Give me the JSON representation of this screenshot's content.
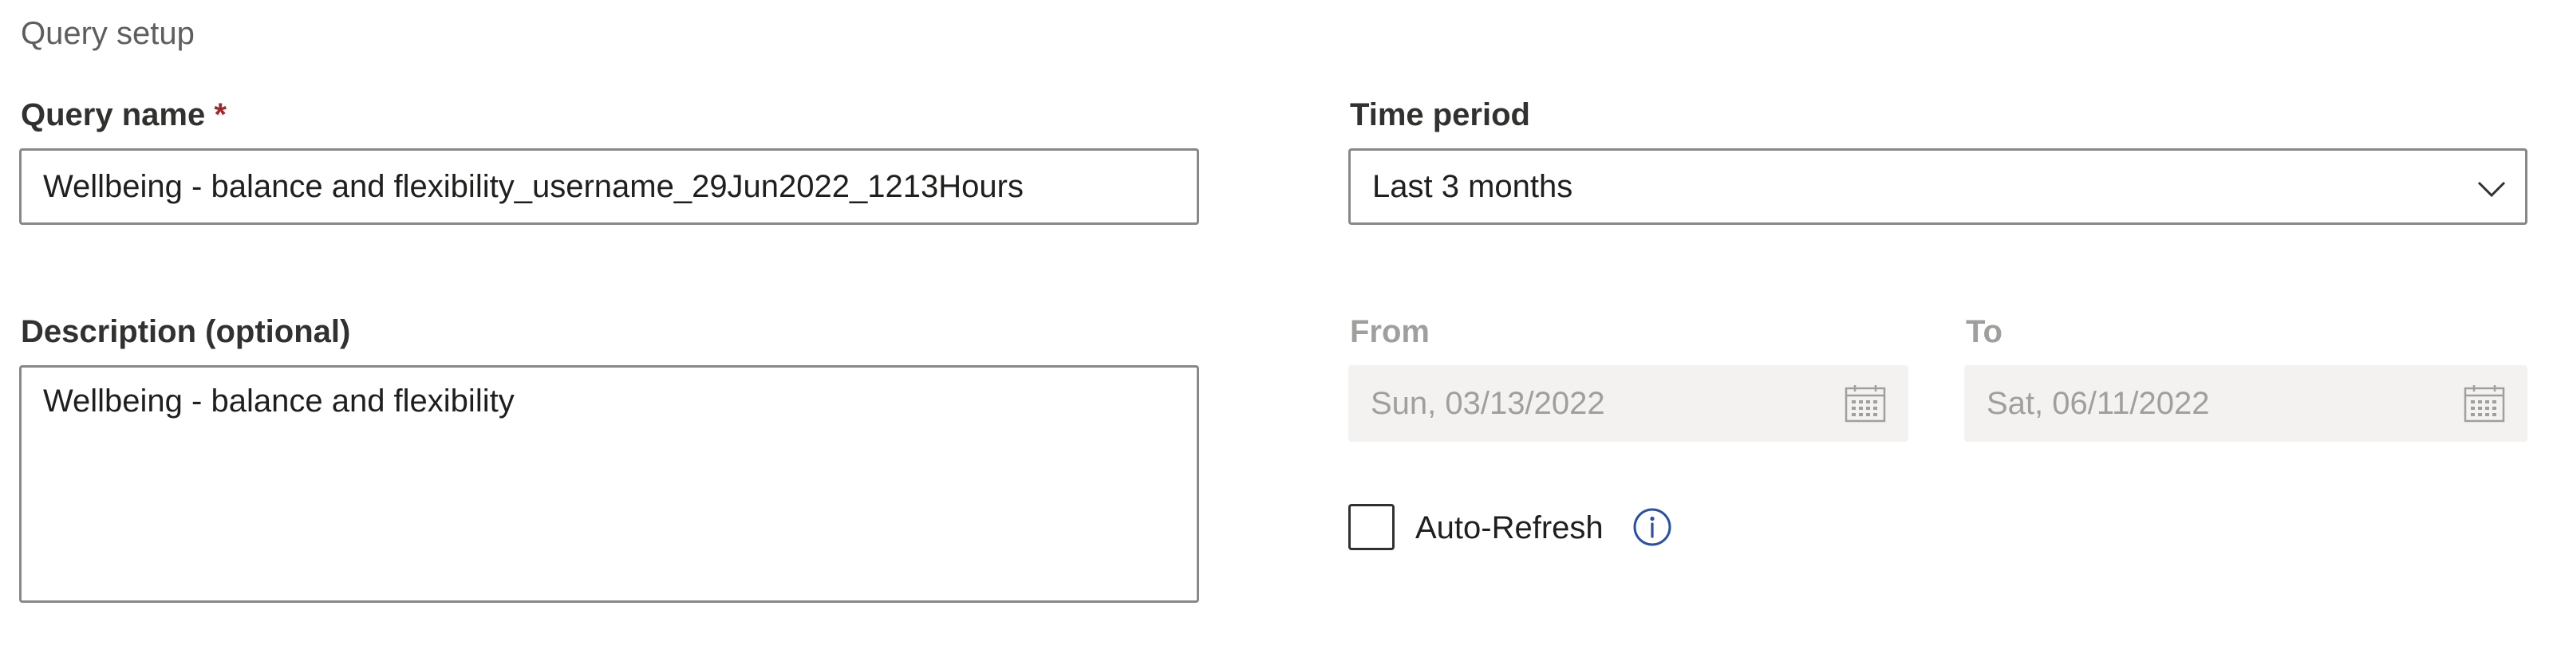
{
  "section": {
    "title": "Query setup"
  },
  "query_name": {
    "label": "Query name",
    "required_marker": "*",
    "value": "Wellbeing - balance and flexibility_username_29Jun2022_1213Hours"
  },
  "description": {
    "label": "Description (optional)",
    "value": "Wellbeing - balance and flexibility"
  },
  "time_period": {
    "label": "Time period",
    "selected": "Last 3 months"
  },
  "from": {
    "label": "From",
    "value": "Sun, 03/13/2022"
  },
  "to": {
    "label": "To",
    "value": "Sat, 06/11/2022"
  },
  "auto_refresh": {
    "label": "Auto-Refresh",
    "checked": false
  },
  "icons": {
    "dropdown": "chevron-down-icon",
    "calendar": "calendar-icon",
    "info": "info-icon"
  },
  "colors": {
    "required": "#a4262c",
    "info_icon": "#2b4fa8",
    "disabled_text": "#a19f9d",
    "disabled_bg": "#f3f2f1"
  }
}
